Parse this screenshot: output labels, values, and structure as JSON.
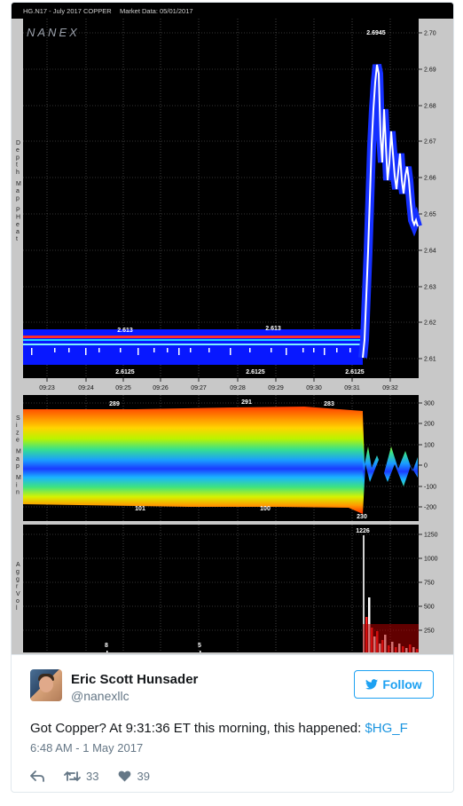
{
  "chart": {
    "header_symbol": "HG.N17 - July 2017 COPPER",
    "header_date": "Market Data: 05/01/2017",
    "logo": "NANEX",
    "panel1_side_label": "Depth Map PHeat",
    "panel2_side_label": "Size Map Min",
    "panel3_side_label": "AggrVol",
    "price_axis": [
      "2.70",
      "2.69",
      "2.68",
      "2.67",
      "2.66",
      "2.65",
      "2.64",
      "2.63",
      "2.62",
      "2.61"
    ],
    "time_axis": [
      "09:23",
      "09:24",
      "09:25",
      "09:26",
      "09:27",
      "09:28",
      "09:29",
      "09:30",
      "09:31",
      "09:32"
    ],
    "size_axis": [
      "300",
      "200",
      "100",
      "0",
      "-100",
      "-200"
    ],
    "vol_axis": [
      "1250",
      "1000",
      "750",
      "500",
      "250"
    ],
    "annotations": {
      "high": "2.6945",
      "bid_left": "2.613",
      "bid_mid": "2.613",
      "ask_left": "2.6125",
      "ask_mid": "2.6125",
      "ask_right": "2.6125",
      "size_top_1": "289",
      "size_top_2": "291",
      "size_top_3": "283",
      "size_bot_1": "101",
      "size_bot_2": "100",
      "size_bot_3": "230",
      "vol_peak": "1226",
      "vol_1": "8",
      "vol_2": "5"
    },
    "colors": {
      "background": "#000000",
      "bid_band": "#0000ff",
      "price_line": "#ffffff",
      "frame": "#c8c8c8"
    }
  },
  "tweet": {
    "display_name": "Eric Scott Hunsader",
    "handle": "@nanexllc",
    "follow_label": "Follow",
    "text_main": "Got Copper? At 9:31:36 ET this morning, this happened: ",
    "cashtag": "$HG_F",
    "timestamp": "6:48 AM - 1 May 2017",
    "retweets": "33",
    "likes": "39",
    "accent": "#1da1f2"
  }
}
